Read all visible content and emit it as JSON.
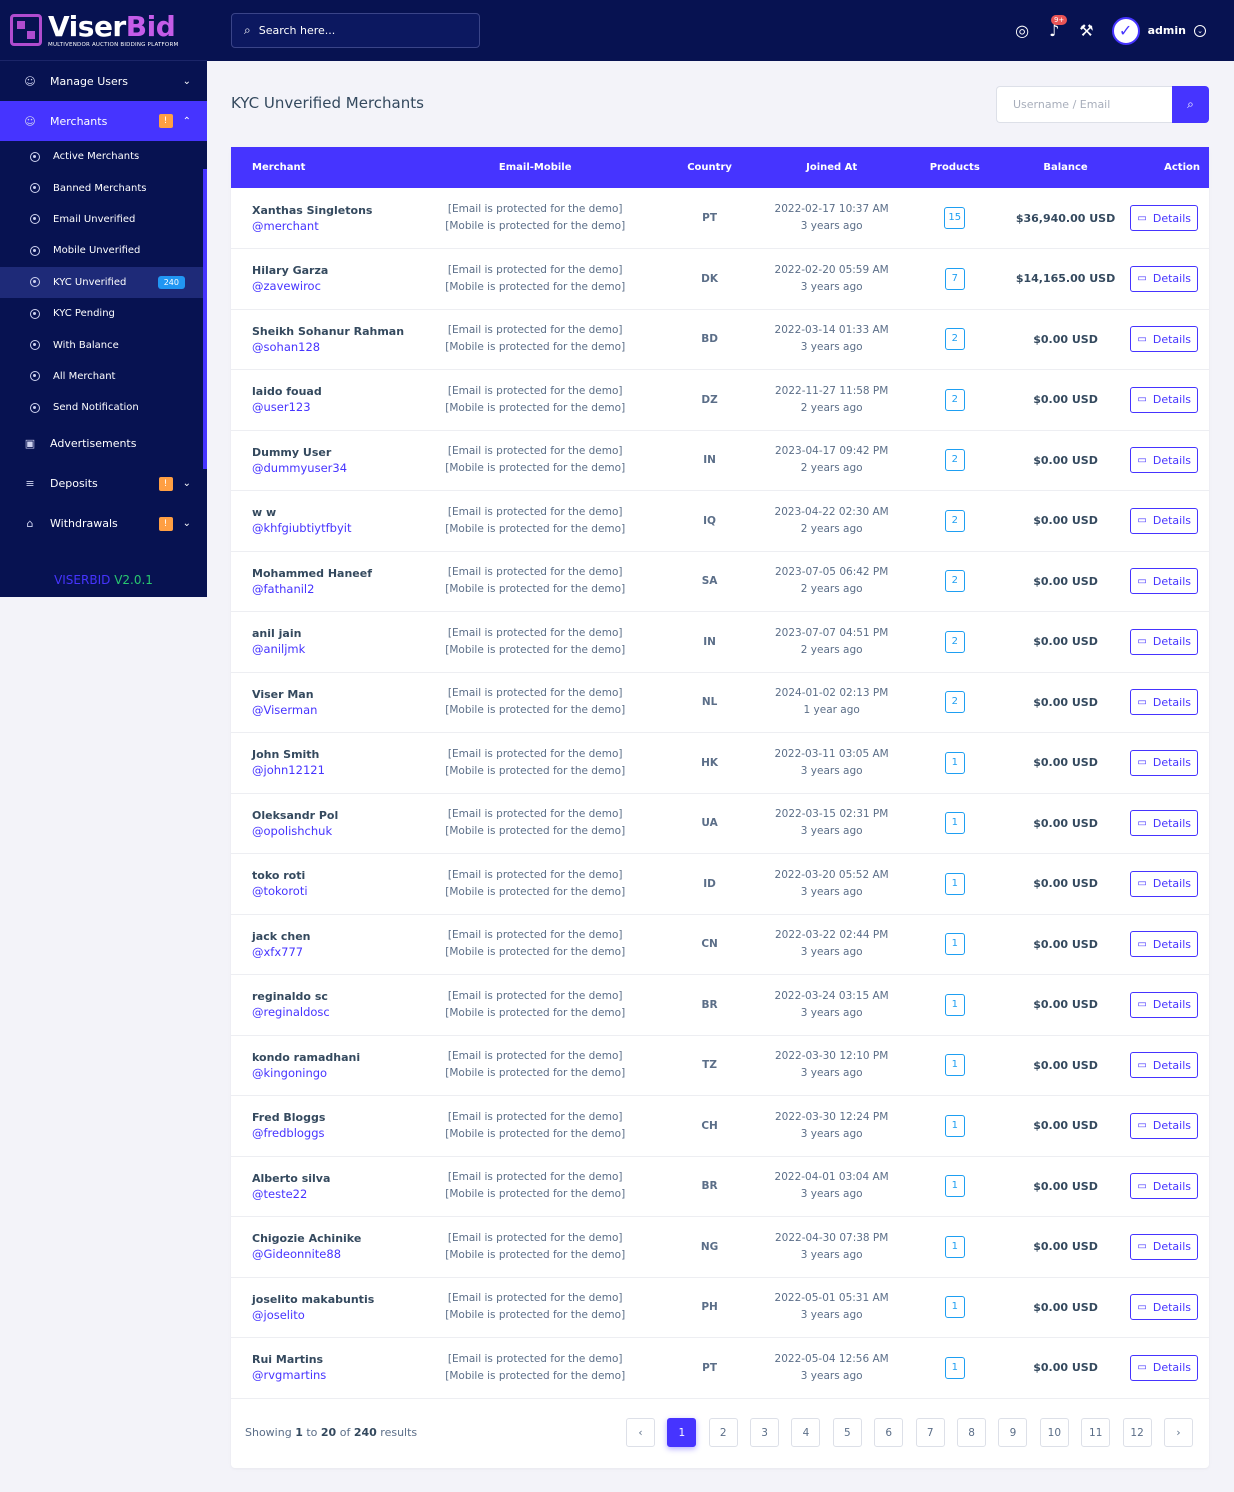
{
  "brand": {
    "name_part1": "Viser",
    "name_part2": "Bid",
    "tagline": "MULTIVENDOR AUCTION BIDDING PLATFORM",
    "version_name": "VISERBID",
    "version_number": "V2.0.1"
  },
  "colors": {
    "primary": "#4634ff",
    "sidebar_bg": "#071251",
    "warning": "#ff9f43",
    "info": "#2196f3"
  },
  "topbar": {
    "search_placeholder": "Search here...",
    "notification_count": "9+",
    "admin_name": "admin",
    "icons": [
      "globe-icon",
      "bell-icon",
      "wrench-icon"
    ]
  },
  "sidebar": {
    "manage_users": "Manage Users",
    "merchants": "Merchants",
    "merchants_badge": "!",
    "submenu": [
      {
        "label": "Active Merchants"
      },
      {
        "label": "Banned Merchants"
      },
      {
        "label": "Email Unverified"
      },
      {
        "label": "Mobile Unverified"
      },
      {
        "label": "KYC Unverified",
        "badge": "240"
      },
      {
        "label": "KYC Pending"
      },
      {
        "label": "With Balance"
      },
      {
        "label": "All Merchant"
      },
      {
        "label": "Send Notification"
      }
    ],
    "advertisements": "Advertisements",
    "deposits": "Deposits",
    "deposits_badge": "!",
    "withdrawals": "Withdrawals",
    "withdrawals_badge": "!"
  },
  "page": {
    "title": "KYC Unverified Merchants",
    "search_placeholder": "Username / Email"
  },
  "table": {
    "headers": [
      "Merchant",
      "Email-Mobile",
      "Country",
      "Joined At",
      "Products",
      "Balance",
      "Action"
    ],
    "email_text": "[Email is protected for the demo]",
    "mobile_text": "[Mobile is protected for the demo]",
    "action_label": "Details",
    "rows": [
      {
        "name": "Xanthas Singletons",
        "username": "@merchant",
        "country": "PT",
        "joined": "2022-02-17 10:37 AM",
        "ago": "3 years ago",
        "products": "15",
        "balance": "$36,940.00 USD"
      },
      {
        "name": "Hilary Garza",
        "username": "@zavewiroc",
        "country": "DK",
        "joined": "2022-02-20 05:59 AM",
        "ago": "3 years ago",
        "products": "7",
        "balance": "$14,165.00 USD"
      },
      {
        "name": "Sheikh Sohanur Rahman",
        "username": "@sohan128",
        "country": "BD",
        "joined": "2022-03-14 01:33 AM",
        "ago": "3 years ago",
        "products": "2",
        "balance": "$0.00 USD"
      },
      {
        "name": "laido fouad",
        "username": "@user123",
        "country": "DZ",
        "joined": "2022-11-27 11:58 PM",
        "ago": "2 years ago",
        "products": "2",
        "balance": "$0.00 USD"
      },
      {
        "name": "Dummy User",
        "username": "@dummyuser34",
        "country": "IN",
        "joined": "2023-04-17 09:42 PM",
        "ago": "2 years ago",
        "products": "2",
        "balance": "$0.00 USD"
      },
      {
        "name": "w w",
        "username": "@khfgiubtiytfbyit",
        "country": "IQ",
        "joined": "2023-04-22 02:30 AM",
        "ago": "2 years ago",
        "products": "2",
        "balance": "$0.00 USD"
      },
      {
        "name": "Mohammed Haneef",
        "username": "@fathanil2",
        "country": "SA",
        "joined": "2023-07-05 06:42 PM",
        "ago": "2 years ago",
        "products": "2",
        "balance": "$0.00 USD"
      },
      {
        "name": "anil jain",
        "username": "@aniljmk",
        "country": "IN",
        "joined": "2023-07-07 04:51 PM",
        "ago": "2 years ago",
        "products": "2",
        "balance": "$0.00 USD"
      },
      {
        "name": "Viser Man",
        "username": "@Viserman",
        "country": "NL",
        "joined": "2024-01-02 02:13 PM",
        "ago": "1 year ago",
        "products": "2",
        "balance": "$0.00 USD"
      },
      {
        "name": "John Smith",
        "username": "@john12121",
        "country": "HK",
        "joined": "2022-03-11 03:05 AM",
        "ago": "3 years ago",
        "products": "1",
        "balance": "$0.00 USD"
      },
      {
        "name": "Oleksandr Pol",
        "username": "@opolishchuk",
        "country": "UA",
        "joined": "2022-03-15 02:31 PM",
        "ago": "3 years ago",
        "products": "1",
        "balance": "$0.00 USD"
      },
      {
        "name": "toko roti",
        "username": "@tokoroti",
        "country": "ID",
        "joined": "2022-03-20 05:52 AM",
        "ago": "3 years ago",
        "products": "1",
        "balance": "$0.00 USD"
      },
      {
        "name": "jack chen",
        "username": "@xfx777",
        "country": "CN",
        "joined": "2022-03-22 02:44 PM",
        "ago": "3 years ago",
        "products": "1",
        "balance": "$0.00 USD"
      },
      {
        "name": "reginaldo sc",
        "username": "@reginaldosc",
        "country": "BR",
        "joined": "2022-03-24 03:15 AM",
        "ago": "3 years ago",
        "products": "1",
        "balance": "$0.00 USD"
      },
      {
        "name": "kondo ramadhani",
        "username": "@kingoningo",
        "country": "TZ",
        "joined": "2022-03-30 12:10 PM",
        "ago": "3 years ago",
        "products": "1",
        "balance": "$0.00 USD"
      },
      {
        "name": "Fred Bloggs",
        "username": "@fredbloggs",
        "country": "CH",
        "joined": "2022-03-30 12:24 PM",
        "ago": "3 years ago",
        "products": "1",
        "balance": "$0.00 USD"
      },
      {
        "name": "Alberto silva",
        "username": "@teste22",
        "country": "BR",
        "joined": "2022-04-01 03:04 AM",
        "ago": "3 years ago",
        "products": "1",
        "balance": "$0.00 USD"
      },
      {
        "name": "Chigozie Achinike",
        "username": "@Gideonnite88",
        "country": "NG",
        "joined": "2022-04-30 07:38 PM",
        "ago": "3 years ago",
        "products": "1",
        "balance": "$0.00 USD"
      },
      {
        "name": "joselito makabuntis",
        "username": "@joselito",
        "country": "PH",
        "joined": "2022-05-01 05:31 AM",
        "ago": "3 years ago",
        "products": "1",
        "balance": "$0.00 USD"
      },
      {
        "name": "Rui Martins",
        "username": "@rvgmartins",
        "country": "PT",
        "joined": "2022-05-04 12:56 AM",
        "ago": "3 years ago",
        "products": "1",
        "balance": "$0.00 USD"
      }
    ]
  },
  "footer": {
    "showing_prefix": "Showing",
    "from": "1",
    "to_word": "to",
    "to": "20",
    "of_word": "of",
    "total": "240",
    "results_word": "results",
    "prev": "‹",
    "next": "›",
    "pages": [
      "1",
      "2",
      "3",
      "4",
      "5",
      "6",
      "7",
      "8",
      "9",
      "10",
      "11",
      "12"
    ],
    "current_page": "1"
  }
}
